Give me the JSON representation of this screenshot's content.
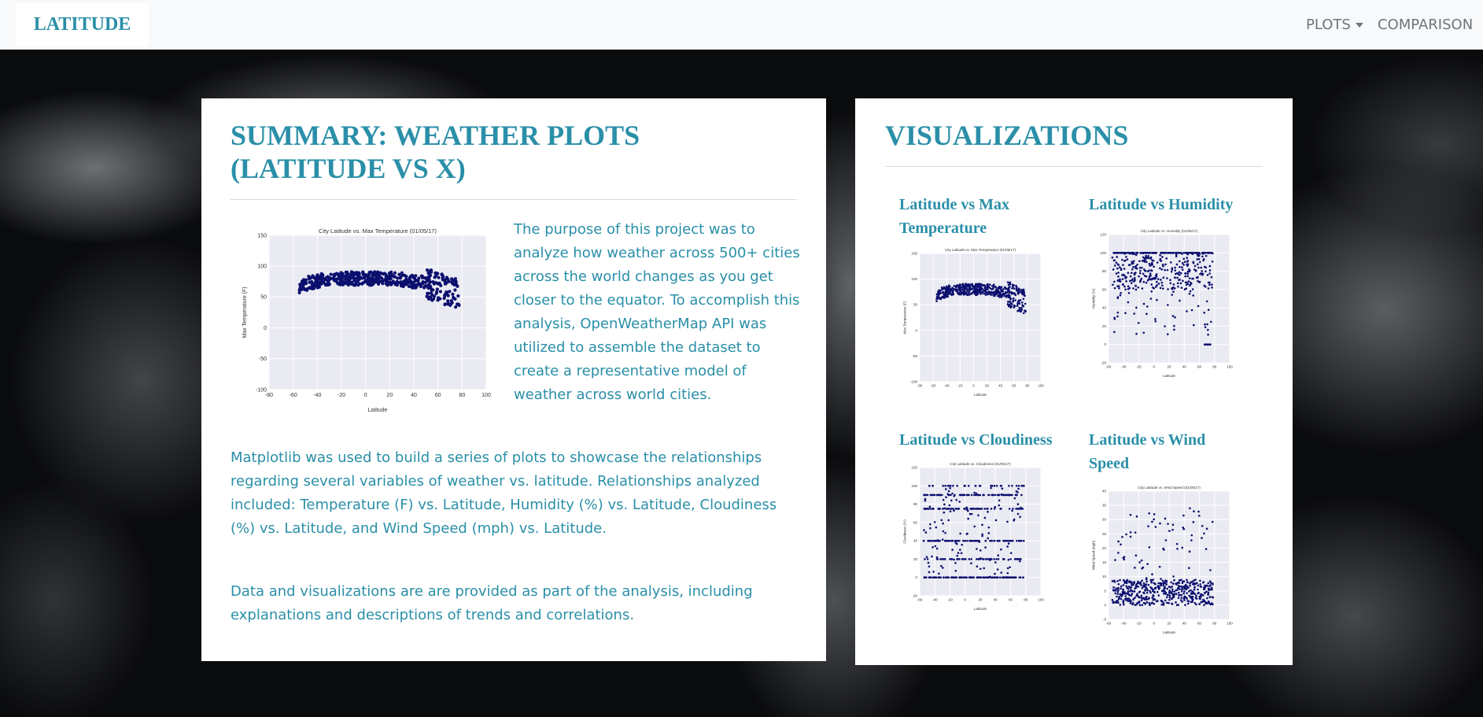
{
  "navbar": {
    "brand": "LATITUDE",
    "plots_label": "PLOTS",
    "comparison_label": "COMPARISON"
  },
  "summary": {
    "title": "SUMMARY: WEATHER PLOTS (LATITUDE VS X)",
    "paragraph1": "The purpose of this project was to analyze how weather across 500+ cities across the world changes as you get closer to the equator. To accomplish this analysis, OpenWeatherMap API was utilized to assemble the dataset to create a representative model of weather across world cities.",
    "paragraph2": "Matplotlib was used to build a series of plots to showcase the relationships regarding several variables of weather vs. latitude. Relationships analyzed included: Temperature (F) vs. Latitude, Humidity (%) vs. Latitude, Cloudiness (%) vs. Latitude, and Wind Speed (mph) vs. Latitude.",
    "paragraph3": "Data and visualizations are are provided as part of the analysis, including explanations and descriptions of trends and correlations."
  },
  "visualizations": {
    "title": "VISUALIZATIONS",
    "items": [
      {
        "label": "Latitude vs Max Temperature"
      },
      {
        "label": "Latitude vs Humidity"
      },
      {
        "label": "Latitude vs Cloudiness"
      },
      {
        "label": "Latitude vs Wind Speed"
      }
    ]
  },
  "colors": {
    "accent": "#2a8fa8",
    "point": "#0b0f6e",
    "plot_bg": "#eaeaf2",
    "nav_bg": "#f8f9fa"
  },
  "chart_data": [
    {
      "type": "scatter",
      "id": "temp",
      "title": "City Latitude vs. Max Temperature (01/05/17)",
      "xlabel": "Latitude",
      "ylabel": "Max Temperature (F)",
      "xlim": [
        -80,
        100
      ],
      "ylim": [
        -100,
        150
      ],
      "xticks": [
        -80,
        -60,
        -40,
        -20,
        0,
        20,
        40,
        60,
        80,
        100
      ],
      "yticks": [
        -100,
        -50,
        0,
        50,
        100,
        150
      ],
      "trend": "temperature peaks near 80F between -20 and 20 latitude, falling sharply toward -50F above 60 latitude"
    },
    {
      "type": "scatter",
      "id": "humidity",
      "title": "City Latitude vs. Humidity (01/05/17)",
      "xlabel": "Latitude",
      "ylabel": "Humidity (%)",
      "xlim": [
        -60,
        100
      ],
      "ylim": [
        -20,
        120
      ],
      "xticks": [
        -60,
        -40,
        -20,
        0,
        20,
        40,
        60,
        80,
        100
      ],
      "yticks": [
        -20,
        0,
        20,
        40,
        60,
        80,
        100,
        120
      ],
      "trend": "most points between 60 and 100 percent, dense band at 100"
    },
    {
      "type": "scatter",
      "id": "cloudiness",
      "title": "City Latitude vs. Cloudiness (01/05/17)",
      "xlabel": "Latitude",
      "ylabel": "Cloudiness (%)",
      "xlim": [
        -60,
        100
      ],
      "ylim": [
        -20,
        120
      ],
      "xticks": [
        -60,
        -40,
        -20,
        0,
        20,
        40,
        60,
        80,
        100
      ],
      "yticks": [
        -20,
        0,
        20,
        40,
        60,
        80,
        100,
        120
      ],
      "trend": "points clustered in horizontal bands at 0, 20, 40, 75 and 90 percent"
    },
    {
      "type": "scatter",
      "id": "wind",
      "title": "City Latitude vs. Wind Speed (01/05/17)",
      "xlabel": "Latitude",
      "ylabel": "Wind Speed (mph)",
      "xlim": [
        -60,
        100
      ],
      "ylim": [
        -5,
        40
      ],
      "xticks": [
        -60,
        -40,
        -20,
        0,
        20,
        40,
        60,
        80,
        100
      ],
      "yticks": [
        -5,
        0,
        5,
        10,
        15,
        20,
        25,
        30,
        35,
        40
      ],
      "trend": "most wind speeds below 10 mph with scattered outliers up to 35"
    }
  ]
}
